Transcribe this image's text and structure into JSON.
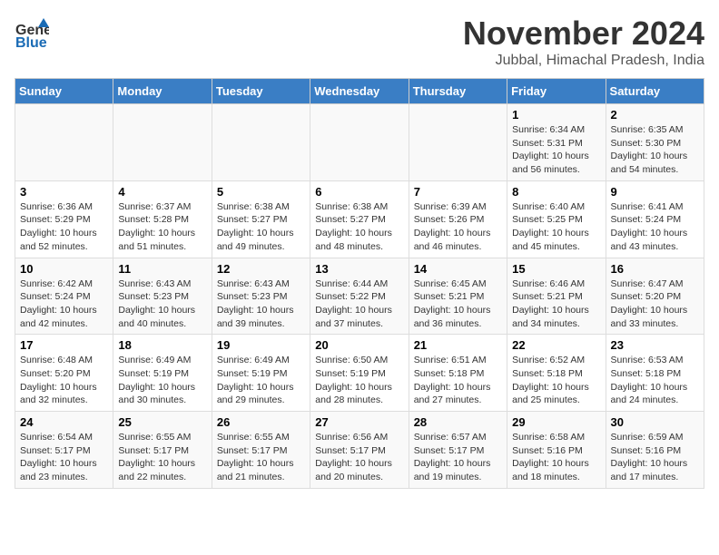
{
  "logo": {
    "general": "General",
    "blue": "Blue"
  },
  "header": {
    "month": "November 2024",
    "location": "Jubbal, Himachal Pradesh, India"
  },
  "weekdays": [
    "Sunday",
    "Monday",
    "Tuesday",
    "Wednesday",
    "Thursday",
    "Friday",
    "Saturday"
  ],
  "weeks": [
    [
      {
        "day": "",
        "info": ""
      },
      {
        "day": "",
        "info": ""
      },
      {
        "day": "",
        "info": ""
      },
      {
        "day": "",
        "info": ""
      },
      {
        "day": "",
        "info": ""
      },
      {
        "day": "1",
        "info": "Sunrise: 6:34 AM\nSunset: 5:31 PM\nDaylight: 10 hours\nand 56 minutes."
      },
      {
        "day": "2",
        "info": "Sunrise: 6:35 AM\nSunset: 5:30 PM\nDaylight: 10 hours\nand 54 minutes."
      }
    ],
    [
      {
        "day": "3",
        "info": "Sunrise: 6:36 AM\nSunset: 5:29 PM\nDaylight: 10 hours\nand 52 minutes."
      },
      {
        "day": "4",
        "info": "Sunrise: 6:37 AM\nSunset: 5:28 PM\nDaylight: 10 hours\nand 51 minutes."
      },
      {
        "day": "5",
        "info": "Sunrise: 6:38 AM\nSunset: 5:27 PM\nDaylight: 10 hours\nand 49 minutes."
      },
      {
        "day": "6",
        "info": "Sunrise: 6:38 AM\nSunset: 5:27 PM\nDaylight: 10 hours\nand 48 minutes."
      },
      {
        "day": "7",
        "info": "Sunrise: 6:39 AM\nSunset: 5:26 PM\nDaylight: 10 hours\nand 46 minutes."
      },
      {
        "day": "8",
        "info": "Sunrise: 6:40 AM\nSunset: 5:25 PM\nDaylight: 10 hours\nand 45 minutes."
      },
      {
        "day": "9",
        "info": "Sunrise: 6:41 AM\nSunset: 5:24 PM\nDaylight: 10 hours\nand 43 minutes."
      }
    ],
    [
      {
        "day": "10",
        "info": "Sunrise: 6:42 AM\nSunset: 5:24 PM\nDaylight: 10 hours\nand 42 minutes."
      },
      {
        "day": "11",
        "info": "Sunrise: 6:43 AM\nSunset: 5:23 PM\nDaylight: 10 hours\nand 40 minutes."
      },
      {
        "day": "12",
        "info": "Sunrise: 6:43 AM\nSunset: 5:23 PM\nDaylight: 10 hours\nand 39 minutes."
      },
      {
        "day": "13",
        "info": "Sunrise: 6:44 AM\nSunset: 5:22 PM\nDaylight: 10 hours\nand 37 minutes."
      },
      {
        "day": "14",
        "info": "Sunrise: 6:45 AM\nSunset: 5:21 PM\nDaylight: 10 hours\nand 36 minutes."
      },
      {
        "day": "15",
        "info": "Sunrise: 6:46 AM\nSunset: 5:21 PM\nDaylight: 10 hours\nand 34 minutes."
      },
      {
        "day": "16",
        "info": "Sunrise: 6:47 AM\nSunset: 5:20 PM\nDaylight: 10 hours\nand 33 minutes."
      }
    ],
    [
      {
        "day": "17",
        "info": "Sunrise: 6:48 AM\nSunset: 5:20 PM\nDaylight: 10 hours\nand 32 minutes."
      },
      {
        "day": "18",
        "info": "Sunrise: 6:49 AM\nSunset: 5:19 PM\nDaylight: 10 hours\nand 30 minutes."
      },
      {
        "day": "19",
        "info": "Sunrise: 6:49 AM\nSunset: 5:19 PM\nDaylight: 10 hours\nand 29 minutes."
      },
      {
        "day": "20",
        "info": "Sunrise: 6:50 AM\nSunset: 5:19 PM\nDaylight: 10 hours\nand 28 minutes."
      },
      {
        "day": "21",
        "info": "Sunrise: 6:51 AM\nSunset: 5:18 PM\nDaylight: 10 hours\nand 27 minutes."
      },
      {
        "day": "22",
        "info": "Sunrise: 6:52 AM\nSunset: 5:18 PM\nDaylight: 10 hours\nand 25 minutes."
      },
      {
        "day": "23",
        "info": "Sunrise: 6:53 AM\nSunset: 5:18 PM\nDaylight: 10 hours\nand 24 minutes."
      }
    ],
    [
      {
        "day": "24",
        "info": "Sunrise: 6:54 AM\nSunset: 5:17 PM\nDaylight: 10 hours\nand 23 minutes."
      },
      {
        "day": "25",
        "info": "Sunrise: 6:55 AM\nSunset: 5:17 PM\nDaylight: 10 hours\nand 22 minutes."
      },
      {
        "day": "26",
        "info": "Sunrise: 6:55 AM\nSunset: 5:17 PM\nDaylight: 10 hours\nand 21 minutes."
      },
      {
        "day": "27",
        "info": "Sunrise: 6:56 AM\nSunset: 5:17 PM\nDaylight: 10 hours\nand 20 minutes."
      },
      {
        "day": "28",
        "info": "Sunrise: 6:57 AM\nSunset: 5:17 PM\nDaylight: 10 hours\nand 19 minutes."
      },
      {
        "day": "29",
        "info": "Sunrise: 6:58 AM\nSunset: 5:16 PM\nDaylight: 10 hours\nand 18 minutes."
      },
      {
        "day": "30",
        "info": "Sunrise: 6:59 AM\nSunset: 5:16 PM\nDaylight: 10 hours\nand 17 minutes."
      }
    ]
  ]
}
